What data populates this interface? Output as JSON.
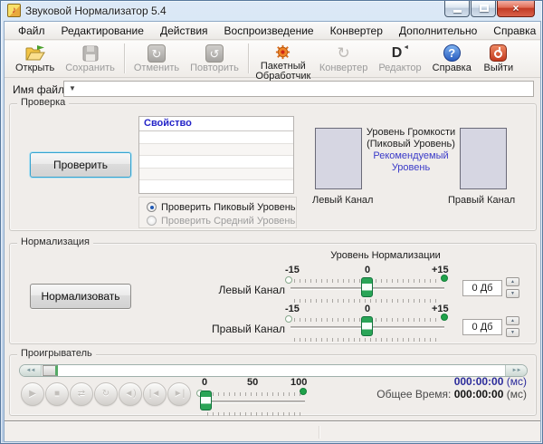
{
  "window": {
    "title": "Звуковой Нормализатор 5.4"
  },
  "icons": {
    "note": "♪",
    "close": "×",
    "combo_arrow": "▼",
    "question": "?",
    "undo": "↻",
    "redo": "↺",
    "converter": "↻",
    "editor_d": "D",
    "editor_caret": "◄",
    "spin_up": "▲",
    "spin_down": "▼",
    "seek_left": "◄◄",
    "seek_right": "►►"
  },
  "menu": {
    "items": [
      {
        "label": "Файл"
      },
      {
        "label": "Редактирование"
      },
      {
        "label": "Действия"
      },
      {
        "label": "Воспроизведение"
      },
      {
        "label": "Конвертер"
      },
      {
        "label": "Дополнительно"
      },
      {
        "label": "Справка"
      }
    ]
  },
  "toolbar": {
    "buttons": [
      {
        "label": "Открыть",
        "enabled": true
      },
      {
        "label": "Сохранить",
        "enabled": false
      },
      {
        "label": "Отменить",
        "enabled": false
      },
      {
        "label": "Повторить",
        "enabled": false
      },
      {
        "label": "Пакетный Обработчик",
        "enabled": true
      },
      {
        "label": "Конвертер",
        "enabled": false
      },
      {
        "label": "Редактор",
        "enabled": false
      },
      {
        "label": "Справка",
        "enabled": true
      },
      {
        "label": "Выйти",
        "enabled": true
      }
    ]
  },
  "file_row": {
    "label": "Имя файла:",
    "value": ""
  },
  "check_group": {
    "title": "Проверка",
    "check_button": "Проверить",
    "table": {
      "header": "Свойство",
      "rows": [
        "",
        "",
        "",
        "",
        ""
      ]
    },
    "radios": [
      {
        "label": "Проверить Пиковый Уровень",
        "selected": true
      },
      {
        "label": "Проверить Средний Уровень",
        "selected": false
      }
    ],
    "meter_title_line1": "Уровень Громкости",
    "meter_title_line2": "(Пиковый Уровень)",
    "recommended_line1": "Рекомендуемый",
    "recommended_line2": "Уровень",
    "left_channel_label": "Левый Канал",
    "right_channel_label": "Правый Канал"
  },
  "normalize_group": {
    "title": "Нормализация",
    "normalize_button": "Нормализовать",
    "slider_title": "Уровень Нормализации",
    "scale": {
      "low": "-15",
      "mid": "0",
      "high": "+15"
    },
    "rows": [
      {
        "label": "Левый Канал",
        "value": "0 Дб",
        "position": 0
      },
      {
        "label": "Правый Канал",
        "value": "0 Дб",
        "position": 0
      }
    ]
  },
  "player_group": {
    "title": "Проигрыватель",
    "buttons": [
      {
        "name": "play",
        "glyph": "▶"
      },
      {
        "name": "stop",
        "glyph": "■"
      },
      {
        "name": "shuffle",
        "glyph": "⇄"
      },
      {
        "name": "repeat",
        "glyph": "↻"
      },
      {
        "name": "volume",
        "glyph": "◄)"
      },
      {
        "name": "previous",
        "glyph": "|◄"
      },
      {
        "name": "next",
        "glyph": "►|"
      }
    ],
    "volume_scale": {
      "low": "0",
      "mid": "50",
      "high": "100"
    },
    "time_current": "000:00:00",
    "time_unit": "(мс)",
    "total_label": "Общее Время:",
    "time_total": "000:00:00"
  },
  "status_bar": {
    "left": "",
    "right": ""
  },
  "colors": {
    "accent_blue": "#3a3ac8",
    "table_header_blue": "#2424c8",
    "green": "#1fa24a",
    "time_navy": "#2b2b9b",
    "meter_fill": "#d6d6e2"
  }
}
